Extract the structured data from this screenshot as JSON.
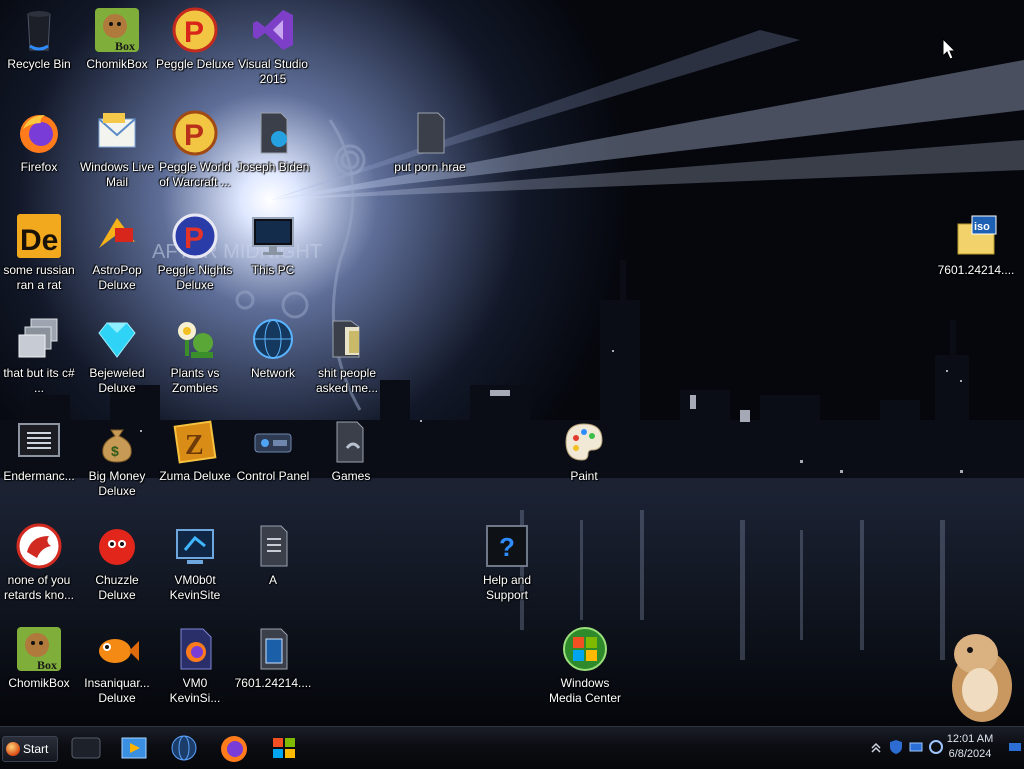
{
  "desktop": {
    "icons": [
      {
        "id": "recycle-bin",
        "label": "Recycle Bin"
      },
      {
        "id": "chomikbox-1",
        "label": "ChomikBox"
      },
      {
        "id": "peggle-deluxe",
        "label": "Peggle Deluxe"
      },
      {
        "id": "visual-studio",
        "label": "Visual Studio\n2015"
      },
      {
        "id": "firefox",
        "label": "Firefox"
      },
      {
        "id": "windows-live-mail",
        "label": "Windows Live\nMail"
      },
      {
        "id": "peggle-world-of-warcraft",
        "label": "Peggle World\nof Warcraft ..."
      },
      {
        "id": "joseph-biden",
        "label": "Joseph Biden"
      },
      {
        "id": "put-porn-hrae",
        "label": "put porn hrae"
      },
      {
        "id": "some-russian",
        "label": "some russian\nran a rat"
      },
      {
        "id": "astropop",
        "label": "AstroPop\nDeluxe"
      },
      {
        "id": "peggle-nights",
        "label": "Peggle Nights\nDeluxe"
      },
      {
        "id": "this-pc",
        "label": "This PC"
      },
      {
        "id": "iso-file",
        "label": "7601.24214...."
      },
      {
        "id": "that-but-its-csharp",
        "label": "that but its c#\n..."
      },
      {
        "id": "bejeweled",
        "label": "Bejeweled\nDeluxe"
      },
      {
        "id": "plants-vs-zombies",
        "label": "Plants vs\nZombies"
      },
      {
        "id": "network",
        "label": "Network"
      },
      {
        "id": "shit-people-asked-me",
        "label": "shit people\nasked me..."
      },
      {
        "id": "endermanch",
        "label": "Endermanc..."
      },
      {
        "id": "big-money",
        "label": "Big Money\nDeluxe"
      },
      {
        "id": "zuma",
        "label": "Zuma Deluxe"
      },
      {
        "id": "control-panel",
        "label": "Control Panel"
      },
      {
        "id": "games",
        "label": "Games"
      },
      {
        "id": "paint",
        "label": "Paint"
      },
      {
        "id": "none-of-you",
        "label": "none of you\nretards kno..."
      },
      {
        "id": "chuzzle",
        "label": "Chuzzle\nDeluxe"
      },
      {
        "id": "vm0b0t",
        "label": "VM0b0t\nKevinSite"
      },
      {
        "id": "a-file",
        "label": "A"
      },
      {
        "id": "help-and-support",
        "label": "Help and\nSupport"
      },
      {
        "id": "chomikbox-2",
        "label": "ChomikBox"
      },
      {
        "id": "insaniquarium",
        "label": "Insaniquar...\nDeluxe"
      },
      {
        "id": "vm0-kevinsi",
        "label": "VM0\nKevinSi..."
      },
      {
        "id": "iso-file-2",
        "label": "7601.24214...."
      },
      {
        "id": "wmc",
        "label": "Windows\nMedia Center"
      }
    ],
    "wallpaper_text": "AFTER MIDNIGHT"
  },
  "taskbar": {
    "start_label": "Start",
    "pinned": [
      "media-player-dark",
      "windows-media-player",
      "network-globe",
      "firefox",
      "windows-explorer"
    ],
    "clock_time": "12:01 AM",
    "clock_date": "6/8/2024"
  },
  "colors": {
    "taskbar": "#0b0d12",
    "accent_blue": "#2b6fd6"
  }
}
